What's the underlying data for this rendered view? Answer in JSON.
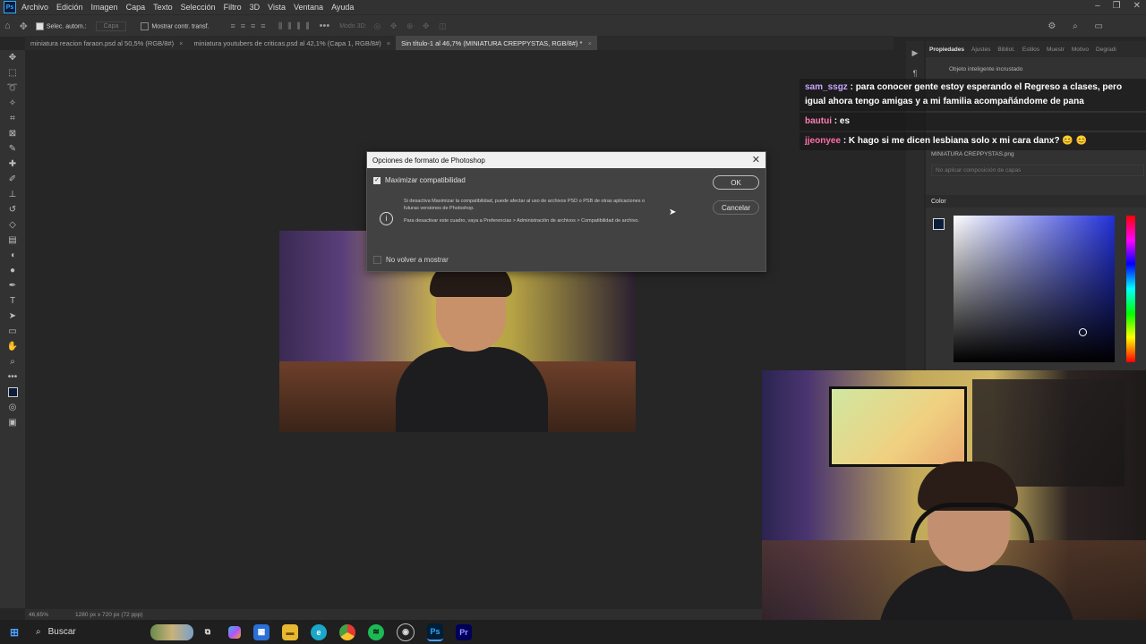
{
  "menubar": {
    "app_icon": "Ps",
    "items": [
      "Archivo",
      "Edición",
      "Imagen",
      "Capa",
      "Texto",
      "Selección",
      "Filtro",
      "3D",
      "Vista",
      "Ventana",
      "Ayuda"
    ]
  },
  "optbar": {
    "auto_select": "Selec. autom.:",
    "layer_value": "Capa",
    "show_transform": "Mostrar contr. transf.",
    "mode_3d": "Modo 3D:"
  },
  "tabs": [
    {
      "label": "miniatura reacion faraon.psd al 50,5% (RGB/8#)",
      "close": "×"
    },
    {
      "label": "miniatura youtubers de criticas.psd al 42,1% (Capa 1, RGB/8#)",
      "close": "×"
    },
    {
      "label": "Sin título-1 al 46,7% (MINIATURA CREPPYSTAS, RGB/8#) *",
      "close": "×"
    }
  ],
  "statusbar": {
    "zoom": "46,65%",
    "doc_size": "1280 px x 720 px (72 ppp)"
  },
  "right_panel": {
    "tabs": [
      "Propiedades",
      "Ajustes",
      "Bibliot.",
      "Estilos",
      "Muestr",
      "Motivo",
      "Degradi"
    ],
    "smart_object": "Objeto inteligente incrustado",
    "file_name": "MINIATURA CREPPYSTAS.png",
    "comp_placeholder": "No aplicar composición de capas",
    "color_label": "Color",
    "accent": "#2230d8"
  },
  "chat": [
    {
      "user": "sam_ssgz",
      "color": "#c9a6ff",
      "text": ": para conocer gente estoy esperando el Regreso a clases, pero igual ahora tengo amigas y a mi familia acompañándome de pana"
    },
    {
      "user": "bautui",
      "color": "#ff7db6",
      "text": ": es"
    },
    {
      "user": "jjeonyee",
      "color": "#ff6fa8",
      "text": ": K hago si me dicen lesbiana solo x mi cara danx? 😊 😊"
    }
  ],
  "dialog": {
    "title": "Opciones de formato de Photoshop",
    "maximize_label": "Maximizar compatibilidad",
    "info_text_1": "Si desactiva Maximizar la compatibilidad, puede afectar al uso de archivos PSD o PSB de otras aplicaciones o futuras versiones de Photoshop.",
    "info_text_2": "Para desactivar este cuadro, vaya a Preferencias > Administración de archivos > Compatibilidad de archivo.",
    "ok_label": "OK",
    "cancel_label": "Cancelar",
    "dont_show_label": "No volver a mostrar",
    "maximize_checked": true,
    "dont_show_checked": false
  },
  "taskbar": {
    "search_label": "Buscar",
    "apps": [
      "task-view",
      "copilot",
      "store",
      "file-explorer",
      "edge",
      "chrome",
      "spotify",
      "obs",
      "photoshop",
      "premiere"
    ],
    "ps_label": "Ps",
    "pr_label": "Pr"
  }
}
